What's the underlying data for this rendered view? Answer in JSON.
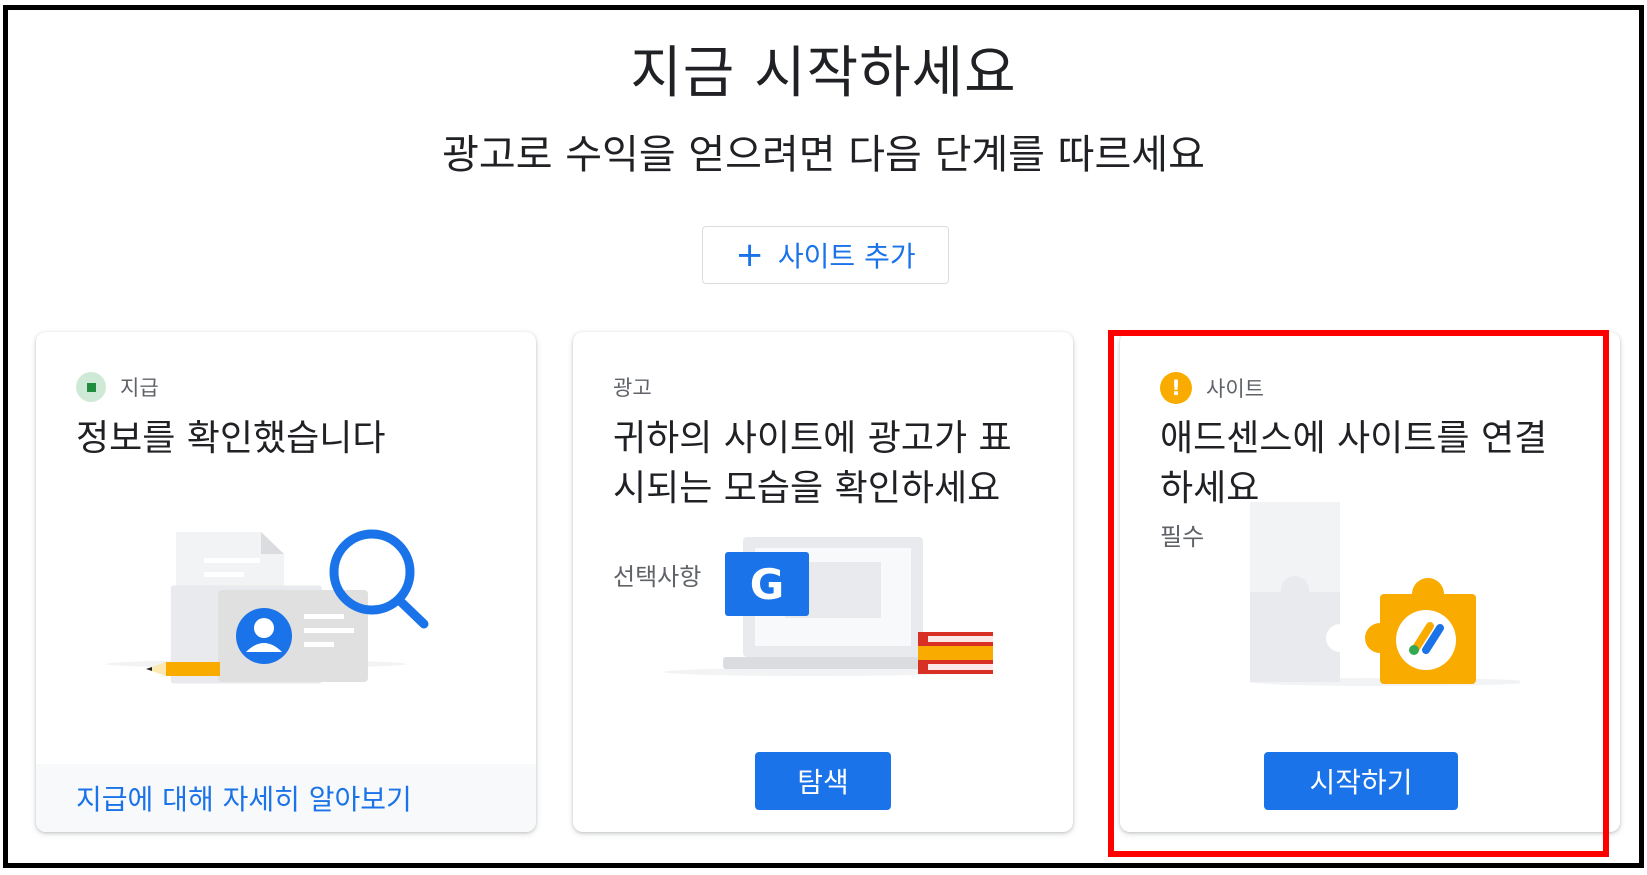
{
  "page": {
    "title": "지금 시작하세요",
    "subtitle": "광고로 수익을 얻으려면 다음 단계를 따르세요"
  },
  "add_site": {
    "icon": "plus-icon",
    "label": "사이트 추가"
  },
  "cards": [
    {
      "eyebrow": "지급",
      "status_icon": "check-square-icon",
      "title": "정보를 확인했습니다",
      "footer_link": "지급에 대해 자세히 알아보기"
    },
    {
      "eyebrow": "광고",
      "title": "귀하의 사이트에 광고가 표시되는 모습을 확인하세요",
      "sub": "선택사항",
      "button": "탐색",
      "illustration_letter": "G"
    },
    {
      "eyebrow": "사이트",
      "status_icon": "warning-icon",
      "status_symbol": "!",
      "title": "애드센스에 사이트를 연결하세요",
      "sub": "필수",
      "button": "시작하기"
    }
  ],
  "colors": {
    "accent": "#1a73e8",
    "ok": "#1e8e3e",
    "warning": "#f9ab00",
    "highlight": "#ff0000"
  }
}
